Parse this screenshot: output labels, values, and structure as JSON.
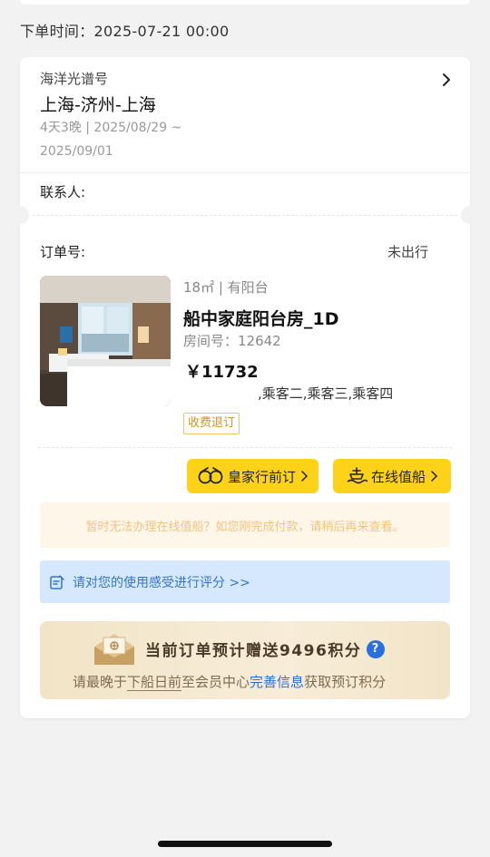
{
  "order_time": "下单时间：2025-07-21 00:00",
  "trip": {
    "ship_name": "海洋光谱号",
    "route": "上海-济州-上海",
    "meta_line1": "4天3晚 | 2025/08/29 ~",
    "meta_line2": "2025/09/01"
  },
  "contact_label": "联系人:",
  "order": {
    "number_label": "订单号:",
    "status": "未出行"
  },
  "room": {
    "area": "18㎡ | 有阳台",
    "type": "船中家庭阳台房_1D",
    "number": "房间号：12642",
    "price": "￥11732",
    "passengers": ",乘客二,乘客三,乘客四",
    "refund_tag": "收费退订"
  },
  "actions": {
    "royal_label": "皇家行前订",
    "checkin_label": "在线值船",
    "royal_icon": "binoculars-icon",
    "checkin_icon": "ship-icon"
  },
  "notice": "暂时无法办理在线值船？如您刚完成付款，请稍后再来查看。",
  "rating": {
    "text": "请对您的使用感受进行评分 >>"
  },
  "points": {
    "title": "当前订单预计赠送9496积分",
    "help": "?",
    "desc_prefix": "请最晚于",
    "desc_underline": "下船日前",
    "desc_middle": "至会员中心",
    "desc_link": "完善信息",
    "desc_suffix": "获取预订积分"
  },
  "colors": {
    "accent_yellow": "#ffd21a",
    "link_blue": "#2a6fe0",
    "rating_bg": "#d6e8fd",
    "notice_text": "#f2c47e"
  }
}
